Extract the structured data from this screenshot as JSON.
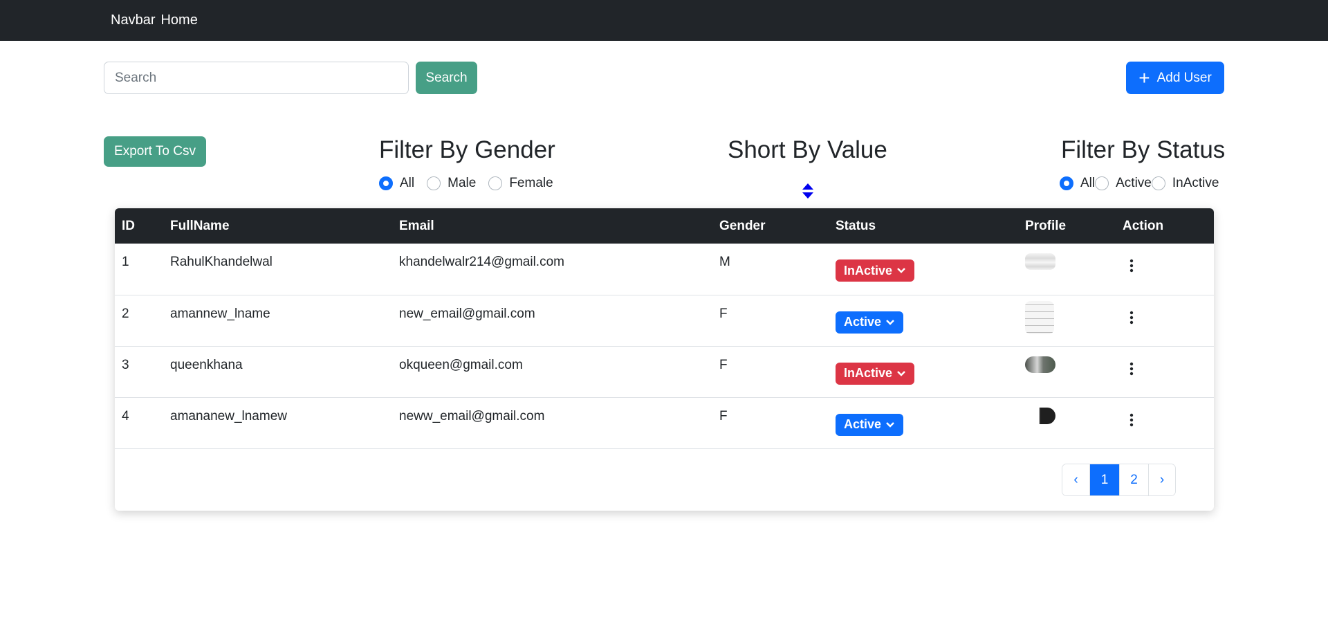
{
  "navbar": {
    "brand": "Navbar",
    "home": "Home"
  },
  "search": {
    "placeholder": "Search",
    "button_label": "Search"
  },
  "add_user": {
    "label": "Add User"
  },
  "export": {
    "label": "Export To Csv"
  },
  "filter_gender": {
    "title": "Filter By Gender",
    "options": [
      "All",
      "Male",
      "Female"
    ],
    "selected": "All"
  },
  "sort": {
    "title": "Short By Value",
    "icon": "sort-icon"
  },
  "filter_status": {
    "title": "Filter By Status",
    "options": [
      "All",
      "Active",
      "InActive"
    ],
    "selected": "All"
  },
  "table": {
    "headers": [
      "ID",
      "FullName",
      "Email",
      "Gender",
      "Status",
      "Profile",
      "Action"
    ],
    "rows": [
      {
        "id": "1",
        "fullname": "RahulKhandelwal",
        "email": "khandelwalr214@gmail.com",
        "gender": "M",
        "status": "InActive"
      },
      {
        "id": "2",
        "fullname": "amannew_lname",
        "email": "new_email@gmail.com",
        "gender": "F",
        "status": "Active"
      },
      {
        "id": "3",
        "fullname": "queenkhana",
        "email": "okqueen@gmail.com",
        "gender": "F",
        "status": "InActive"
      },
      {
        "id": "4",
        "fullname": "amananew_lnamew",
        "email": "neww_email@gmail.com",
        "gender": "F",
        "status": "Active"
      }
    ]
  },
  "pagination": {
    "prev": "‹",
    "pages": [
      "1",
      "2"
    ],
    "current": "1",
    "next": "›"
  },
  "colors": {
    "navbar": "#212529",
    "primary": "#0d6efd",
    "success": "#479f86",
    "danger": "#dc3545"
  }
}
